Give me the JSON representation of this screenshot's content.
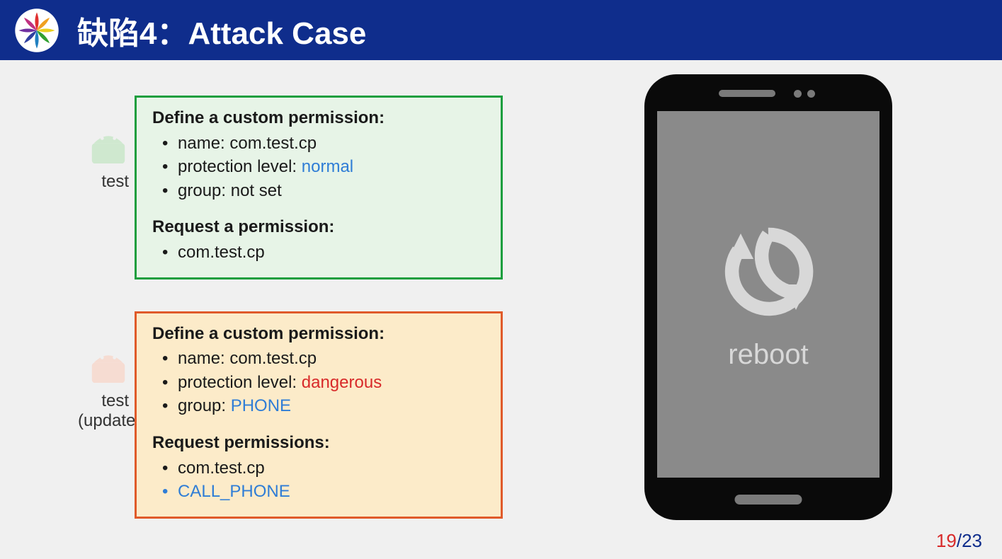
{
  "header": {
    "title": "缺陷4：Attack Case"
  },
  "block1": {
    "label": "test",
    "define_heading": "Define a custom permission:",
    "name_label": "name: ",
    "name_value": "com.test.cp",
    "protection_label": "protection level: ",
    "protection_value": "normal",
    "group_label": "group: ",
    "group_value": "not set",
    "request_heading": "Request a permission:",
    "request_item": "com.test.cp"
  },
  "block2": {
    "label_line1": "test",
    "label_line2": "(updated)",
    "define_heading": "Define a custom permission:",
    "name_label": "name: ",
    "name_value": "com.test.cp",
    "protection_label": "protection level: ",
    "protection_value": "dangerous",
    "group_label": "group: ",
    "group_value": "PHONE",
    "request_heading": "Request permissions:",
    "request_item1": "com.test.cp",
    "request_item2": "CALL_PHONE"
  },
  "phone": {
    "screen_text": "reboot"
  },
  "pager": {
    "current": "19",
    "separator": "/",
    "total": "23"
  }
}
